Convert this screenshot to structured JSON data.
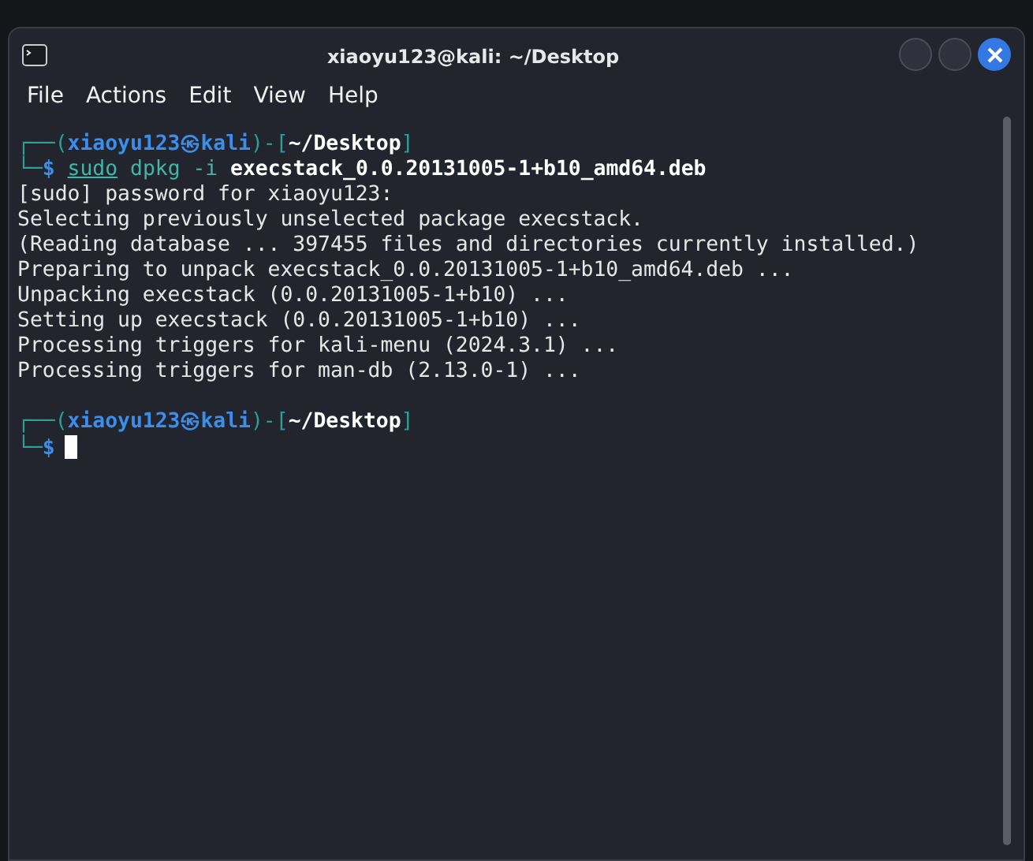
{
  "window": {
    "title": "xiaoyu123@kali: ~/Desktop"
  },
  "menu": [
    "File",
    "Actions",
    "Edit",
    "View",
    "Help"
  ],
  "terminal": {
    "blocks": [
      {
        "prompt": [
          [
            {
              "kind": "frame",
              "text": "┌──("
            },
            {
              "kind": "user",
              "text": "xiaoyu123㉿kali"
            },
            {
              "kind": "frame",
              "text": ")-["
            },
            {
              "kind": "path",
              "text": "~/Desktop"
            },
            {
              "kind": "frame",
              "text": "]"
            }
          ],
          [
            {
              "kind": "frame",
              "text": "└─"
            },
            {
              "kind": "dollar",
              "text": "$"
            },
            {
              "kind": "cmd",
              "text": "sudo"
            },
            {
              "kind": "arg",
              "text": "dpkg -i"
            },
            {
              "kind": "file",
              "text": "execstack_0.0.20131005-1+b10_amd64.deb"
            }
          ]
        ],
        "output": [
          "[sudo] password for xiaoyu123:",
          "Selecting previously unselected package execstack.",
          "(Reading database ... 397455 files and directories currently installed.)",
          "Preparing to unpack execstack_0.0.20131005-1+b10_amd64.deb ...",
          "Unpacking execstack (0.0.20131005-1+b10) ...",
          "Setting up execstack (0.0.20131005-1+b10) ...",
          "Processing triggers for kali-menu (2024.3.1) ...",
          "Processing triggers for man-db (2.13.0-1) ..."
        ],
        "cursor": false
      },
      {
        "prompt": [
          [
            {
              "kind": "frame",
              "text": "┌──("
            },
            {
              "kind": "user",
              "text": "xiaoyu123㉿kali"
            },
            {
              "kind": "frame",
              "text": ")-["
            },
            {
              "kind": "path",
              "text": "~/Desktop"
            },
            {
              "kind": "frame",
              "text": "]"
            }
          ],
          [
            {
              "kind": "frame",
              "text": "└─"
            },
            {
              "kind": "dollar",
              "text": "$"
            }
          ]
        ],
        "cursor": true
      }
    ]
  }
}
